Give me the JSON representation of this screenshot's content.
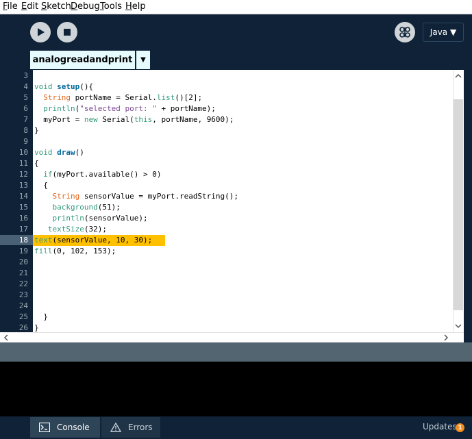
{
  "menu": [
    {
      "label": "File",
      "u": "F",
      "rest": "ile"
    },
    {
      "label": "Edit",
      "u": "E",
      "rest": "dit"
    },
    {
      "label": "Sketch",
      "u": "S",
      "rest": "ketch"
    },
    {
      "label": "Debug",
      "u": "D",
      "rest": "ebug"
    },
    {
      "label": "Tools",
      "u": "T",
      "rest": "ools"
    },
    {
      "label": "Help",
      "u": "H",
      "rest": "elp"
    }
  ],
  "toolbar": {
    "run_icon": "play-icon",
    "stop_icon": "stop-icon",
    "debug_icon": "butterfly-icon",
    "mode_label": "Java ▼"
  },
  "tab": {
    "name": "analogreadandprint",
    "menu_arrow": "▼"
  },
  "editor": {
    "highlight_line": "18",
    "line_numbers": [
      "3",
      "4",
      "5",
      "6",
      "7",
      "8",
      "9",
      "10",
      "11",
      "12",
      "13",
      "14",
      "15",
      "16",
      "17",
      "18",
      "19",
      "20",
      "21",
      "22",
      "23",
      "24",
      "25",
      "26"
    ]
  },
  "status": {
    "console_label": "Console",
    "errors_label": "Errors",
    "updates_label": "Updates",
    "updates_count": "1"
  },
  "colors": {
    "background": "#0f2237",
    "tab": "#e6fbfe",
    "highlight": "#ffc000",
    "divider": "#536570",
    "badge": "#f48c1f"
  }
}
